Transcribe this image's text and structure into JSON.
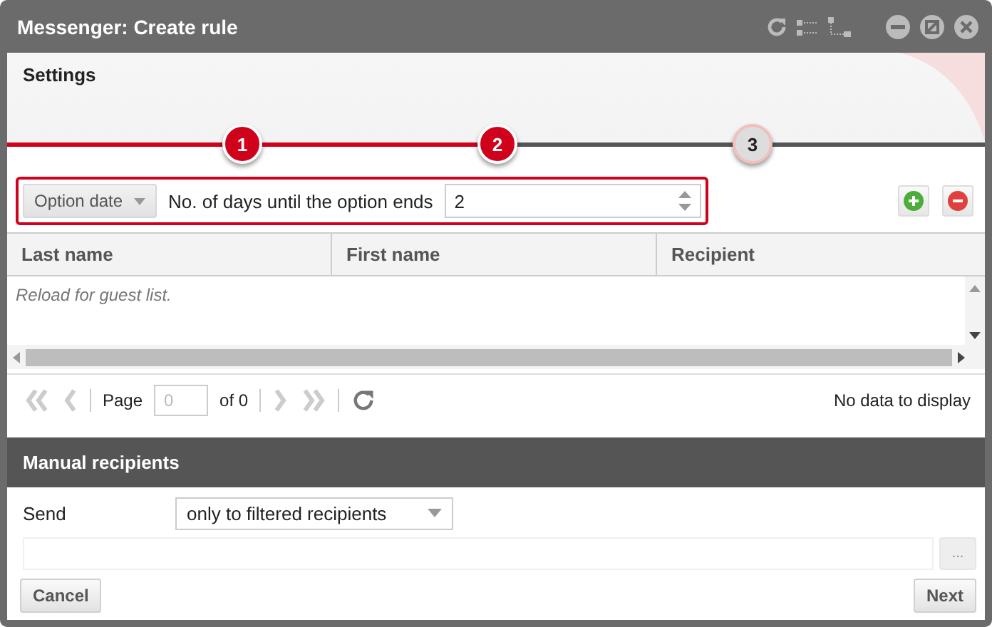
{
  "window": {
    "title": "Messenger: Create rule"
  },
  "header": {
    "title": "Settings"
  },
  "steps": [
    {
      "label": "1",
      "done": true
    },
    {
      "label": "2",
      "done": true
    },
    {
      "label": "3",
      "done": false
    }
  ],
  "filter": {
    "field": "Option date",
    "label": "No. of days until the option ends",
    "value": "2"
  },
  "table": {
    "columns": [
      "Last name",
      "First name",
      "Recipient"
    ],
    "empty_text": "Reload for guest list."
  },
  "paging": {
    "page_label": "Page",
    "page_value": "0",
    "of_label": "of 0",
    "status": "No data to display"
  },
  "manual": {
    "title": "Manual recipients",
    "send_label": "Send",
    "send_value": "only to filtered recipients",
    "browse_button": "..."
  },
  "buttons": {
    "cancel": "Cancel",
    "next": "Next"
  }
}
